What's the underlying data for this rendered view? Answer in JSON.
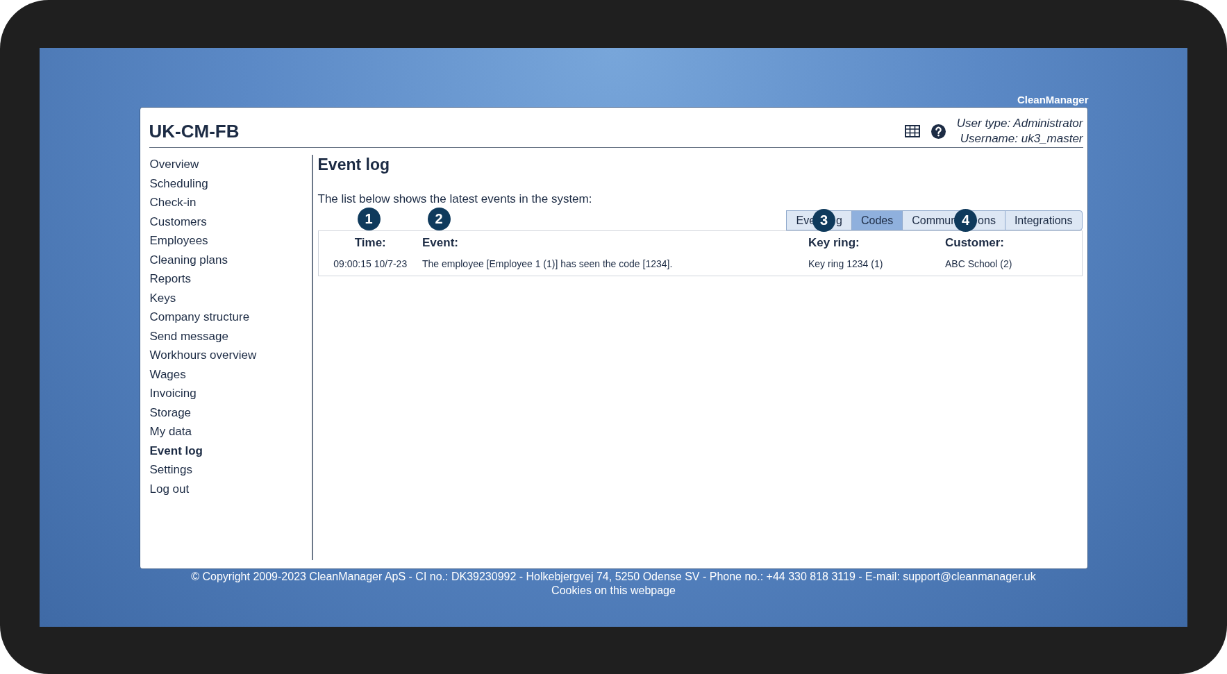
{
  "brand": "CleanManager",
  "window": {
    "title": "UK-CM-FB"
  },
  "user": {
    "type": "User type: Administrator",
    "username": "Username: uk3_master"
  },
  "sidebar": {
    "items": [
      {
        "label": "Overview",
        "selected": false
      },
      {
        "label": "Scheduling",
        "selected": false
      },
      {
        "label": "Check-in",
        "selected": false
      },
      {
        "label": "Customers",
        "selected": false
      },
      {
        "label": "Employees",
        "selected": false
      },
      {
        "label": "Cleaning plans",
        "selected": false
      },
      {
        "label": "Reports",
        "selected": false
      },
      {
        "label": "Keys",
        "selected": false
      },
      {
        "label": "Company structure",
        "selected": false
      },
      {
        "label": "Send message",
        "selected": false
      },
      {
        "label": "Workhours overview",
        "selected": false
      },
      {
        "label": "Wages",
        "selected": false
      },
      {
        "label": "Invoicing",
        "selected": false
      },
      {
        "label": "Storage",
        "selected": false
      },
      {
        "label": "My data",
        "selected": false
      },
      {
        "label": "Event log",
        "selected": true
      },
      {
        "label": "Settings",
        "selected": false
      },
      {
        "label": "Log out",
        "selected": false
      }
    ]
  },
  "page": {
    "heading": "Event log",
    "intro": "The list below shows the latest events in the system:"
  },
  "tabs": [
    {
      "label_parts": [
        "Eve",
        "g"
      ],
      "callout": "3",
      "selected": false
    },
    {
      "label_parts": [
        "Codes"
      ],
      "selected": true
    },
    {
      "label_parts": [
        "Commun",
        "ons"
      ],
      "callout": "4",
      "selected": false
    },
    {
      "label_parts": [
        "Integrations"
      ],
      "selected": false
    }
  ],
  "table": {
    "columns": [
      {
        "label": "Time:",
        "callout": "1"
      },
      {
        "label": "Event:",
        "callout": "2"
      },
      {
        "label": "Key ring:"
      },
      {
        "label": "Customer:"
      }
    ],
    "rows": [
      [
        "09:00:15 10/7-23",
        "The employee [Employee 1 (1)] has seen the code [1234].",
        "Key ring 1234 (1)",
        "ABC School (2)"
      ]
    ]
  },
  "footer": {
    "lines": [
      "© Copyright 2009-2023 CleanManager ApS - CI no.: DK39230992 - Holkebjergvej 74, 5250 Odense SV - Phone no.: +44 330 818 3119 - E-mail: support@cleanmanager.uk",
      "Cookies on this webpage"
    ]
  }
}
